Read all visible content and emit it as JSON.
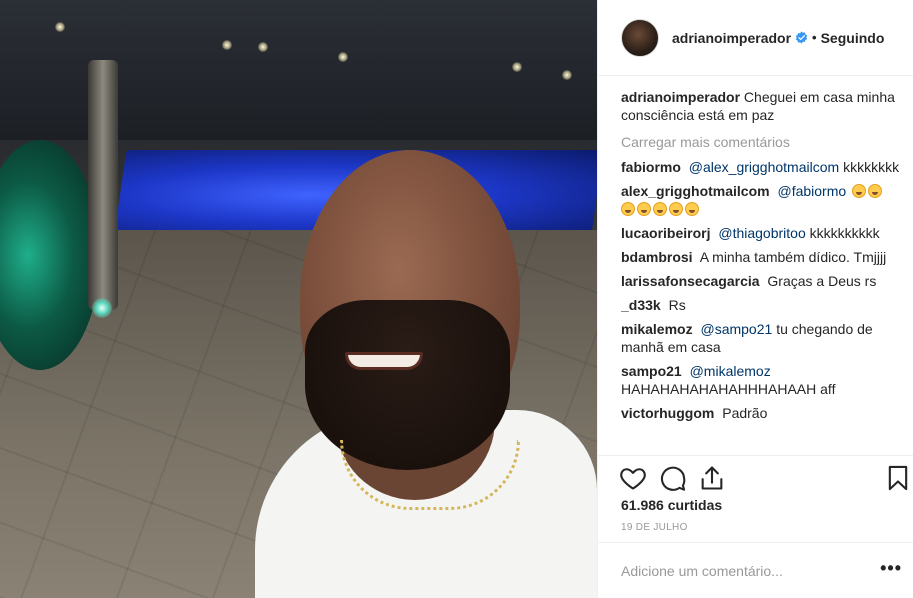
{
  "post": {
    "author": "adrianoimperador",
    "follow_status": "Seguindo",
    "separator": "•",
    "caption": "Cheguei em casa minha consciência está em paz",
    "load_more": "Carregar mais comentários",
    "likes": "61.986 curtidas",
    "date": "19 DE JULHO",
    "add_comment_placeholder": "Adicione um comentário...",
    "more_options": "•••"
  },
  "comments": [
    {
      "user": "fabiormo",
      "mention": "@alex_grigghotmailcom",
      "text": "kkkkkkkk"
    },
    {
      "user": "alex_grigghotmailcom",
      "mention": "@fabiormo",
      "text": "",
      "emoji_count": 7
    },
    {
      "user": "lucaoribeirorj",
      "mention": "@thiagobritoo",
      "text": "kkkkkkkkkk"
    },
    {
      "user": "bdambrosi",
      "mention": "",
      "text": "A minha também dídico. Tmjjjj"
    },
    {
      "user": "larissafonsecagarcia",
      "mention": "",
      "text": "Graças a Deus rs"
    },
    {
      "user": "_d33k",
      "mention": "",
      "text": "Rs"
    },
    {
      "user": "mikalemoz",
      "mention": "@sampo21",
      "text": "tu chegando de manhã em casa"
    },
    {
      "user": "sampo21",
      "mention": "@mikalemoz",
      "text": "HAHAHAHAHAHAHHHAHAAH aff"
    },
    {
      "user": "victorhuggom",
      "mention": "",
      "text": "Padrão"
    }
  ],
  "icons": {
    "like": "heart-icon",
    "comment": "comment-icon",
    "share": "share-icon",
    "save": "bookmark-icon",
    "verified": "verified-badge-icon"
  },
  "colors": {
    "mention": "#003569",
    "muted": "#999999",
    "verified": "#3897f0",
    "text": "#262626"
  }
}
